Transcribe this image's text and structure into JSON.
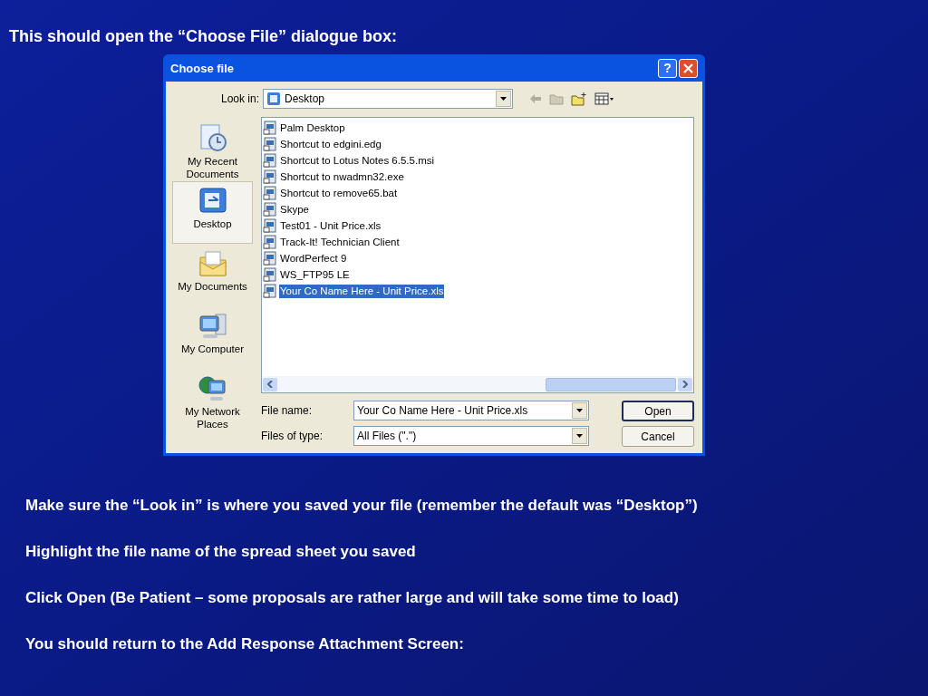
{
  "heading": "This should open the “Choose File” dialogue box:",
  "dialog": {
    "title": "Choose file",
    "help_button": "?",
    "look_in": {
      "label": "Look in:",
      "value": "Desktop"
    },
    "places": [
      {
        "label": "My Recent Documents",
        "kind": "recent",
        "selected": false
      },
      {
        "label": "Desktop",
        "kind": "desktop",
        "selected": true
      },
      {
        "label": "My Documents",
        "kind": "documents",
        "selected": false
      },
      {
        "label": "My Computer",
        "kind": "computer",
        "selected": false
      },
      {
        "label": "My Network Places",
        "kind": "network",
        "selected": false
      }
    ],
    "files": [
      {
        "name": "Palm Desktop",
        "selected": false
      },
      {
        "name": "Shortcut to edgini.edg",
        "selected": false
      },
      {
        "name": "Shortcut to Lotus Notes 6.5.5.msi",
        "selected": false
      },
      {
        "name": "Shortcut to nwadmn32.exe",
        "selected": false
      },
      {
        "name": "Shortcut to remove65.bat",
        "selected": false
      },
      {
        "name": "Skype",
        "selected": false
      },
      {
        "name": "Test01 - Unit Price.xls",
        "selected": false
      },
      {
        "name": "Track-It! Technician Client",
        "selected": false
      },
      {
        "name": "WordPerfect 9",
        "selected": false
      },
      {
        "name": "WS_FTP95 LE",
        "selected": false
      },
      {
        "name": "Your Co Name Here - Unit Price.xls",
        "selected": true
      }
    ],
    "file_name": {
      "label": "File name:",
      "value": "Your Co Name Here - Unit Price.xls"
    },
    "file_type": {
      "label": "Files of type:",
      "value": "All Files (\".\")"
    },
    "buttons": [
      {
        "label": "Open",
        "default": true
      },
      {
        "label": "Cancel",
        "default": false
      }
    ]
  },
  "instructions": [
    "Make sure the “Look in” is where you saved your file (remember the default was “Desktop”)",
    "Highlight the file name of the spread sheet you saved",
    "Click Open  (Be Patient – some proposals are rather large and will take some time to load)",
    "You should return to the Add Response Attachment Screen:"
  ]
}
